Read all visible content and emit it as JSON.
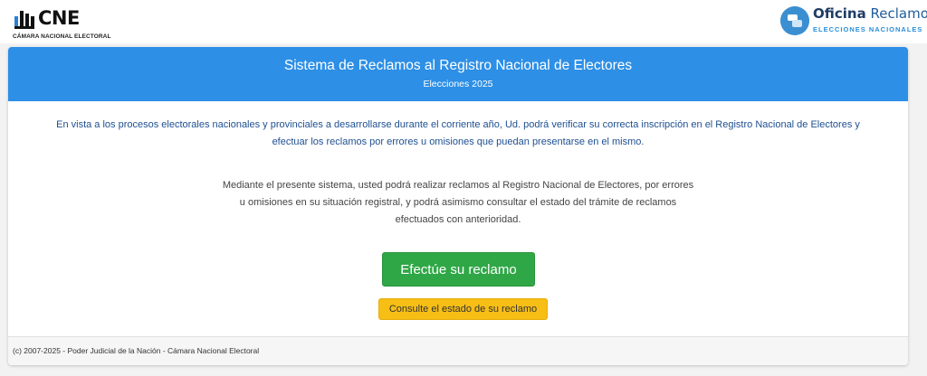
{
  "header": {
    "cne_logo_text": "CNE",
    "cne_logo_subtitle": "CÁMARA NACIONAL ELECTORAL",
    "oficina_title_bold": "Oficina",
    "oficina_title_light": "Reclamos",
    "oficina_subtitle": "ELECCIONES NACIONALES"
  },
  "card": {
    "title": "Sistema de Reclamos al Registro Nacional de Electores",
    "subtitle": "Elecciones 2025",
    "intro_line1": "En vista a los procesos electorales nacionales y provinciales a desarrollarse durante el corriente año, Ud. podrá verificar su correcta inscripción en el Registro Nacional de Electores y",
    "intro_line2": "efectuar los reclamos por errores u omisiones que puedan presentarse en el mismo.",
    "description_line1": "Mediante el presente sistema, usted podrá realizar reclamos al Registro Nacional de Electores, por errores",
    "description_line2": "u omisiones en su situación registral, y podrá asimismo consultar el estado del trámite de reclamos",
    "description_line3": "efectuados con anterioridad.",
    "primary_button": "Efectúe su reclamo",
    "secondary_button": "Consulte el estado de su reclamo",
    "footer": "(c) 2007-2025 - Poder Judicial de la Nación - Cámara Nacional Electoral"
  },
  "colors": {
    "header_blue": "#2d8fe6",
    "intro_text": "#1e4f91",
    "primary_green": "#2fa746",
    "secondary_yellow": "#f7bf16"
  },
  "icons": [
    "cne-logo-icon",
    "oficina-reclamos-logo-icon"
  ]
}
